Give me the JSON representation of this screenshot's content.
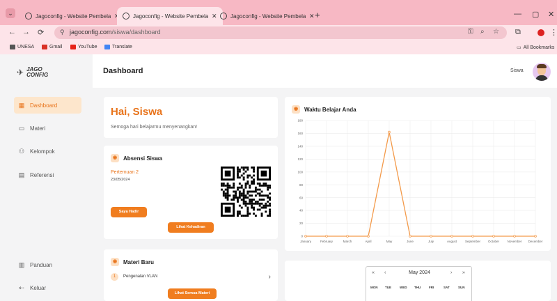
{
  "browser": {
    "tabs": [
      {
        "title": "Jagoconfig - Website Pembelaj...",
        "active": false
      },
      {
        "title": "Jagoconfig - Website Pembelaj...",
        "active": true
      },
      {
        "title": "Jagoconfig - Website Pembelaj...",
        "active": false
      }
    ],
    "close_glyph": "✕",
    "new_tab_glyph": "+",
    "window_controls": [
      "—",
      "▢",
      "✕"
    ],
    "nav": {
      "back": "←",
      "forward": "→",
      "reload": "⟳"
    },
    "url_host": "jagoconfig.com",
    "url_path": "/siswa/dashboard",
    "bookmarks": [
      {
        "label": "UNESA",
        "color": "#555555"
      },
      {
        "label": "Gmail",
        "color": "#d93025"
      },
      {
        "label": "YouTube",
        "color": "#e62117"
      },
      {
        "label": "Translate",
        "color": "#4285f4"
      }
    ],
    "all_bookmarks": "All Bookmarks"
  },
  "brand": {
    "line1": "JAGO",
    "line2": "CONFIG"
  },
  "sidebar": {
    "items": [
      {
        "label": "Dashboard",
        "icon": "grid-icon",
        "glyph": "▦",
        "active": true
      },
      {
        "label": "Materi",
        "icon": "book-icon",
        "glyph": "▭",
        "active": false
      },
      {
        "label": "Kelompok",
        "icon": "group-icon",
        "glyph": "⚇",
        "active": false
      },
      {
        "label": "Referensi",
        "icon": "document-icon",
        "glyph": "▤",
        "active": false
      }
    ],
    "bottom": [
      {
        "label": "Panduan",
        "icon": "guide-icon",
        "glyph": "▥"
      },
      {
        "label": "Keluar",
        "icon": "logout-icon",
        "glyph": "⇠"
      }
    ]
  },
  "header": {
    "title": "Dashboard",
    "user": "Siswa"
  },
  "greeting": {
    "title": "Hai, Siswa",
    "subtitle": "Semoga hari belajarmu menyenangkan!"
  },
  "absensi": {
    "title": "Absensi Siswa",
    "meeting": "Pertemuan 2",
    "date": "23/05/2024",
    "present_button": "Saya Hadir",
    "attendance_button": "Lihat Kehadiran"
  },
  "materi": {
    "title": "Materi Baru",
    "items": [
      {
        "label": "Pengenalan VLAN",
        "number": "1"
      }
    ],
    "all_button": "Lihat Semua Materi"
  },
  "chart_data": {
    "type": "line",
    "title": "Waktu Belajar Anda",
    "categories": [
      "January",
      "February",
      "March",
      "April",
      "May",
      "June",
      "July",
      "August",
      "September",
      "October",
      "November",
      "December"
    ],
    "series": [
      {
        "values": [
          0,
          0,
          0,
          0,
          162,
          0,
          0,
          0,
          0,
          0,
          0,
          0
        ]
      }
    ],
    "ylim": [
      0,
      180
    ],
    "yticks": [
      0,
      20,
      40,
      60,
      80,
      100,
      120,
      140,
      160,
      180
    ],
    "grid": true,
    "color": "#f39a4a"
  },
  "calendar": {
    "title": "May 2024",
    "prev_year": "«",
    "prev_month": "‹",
    "next_month": "›",
    "next_year": "»",
    "weekdays": [
      "MON",
      "TUE",
      "WED",
      "THU",
      "FRI",
      "SAT",
      "SUN"
    ]
  },
  "colors": {
    "accent": "#f07d1f",
    "tab_bar": "#f7b8c4"
  }
}
